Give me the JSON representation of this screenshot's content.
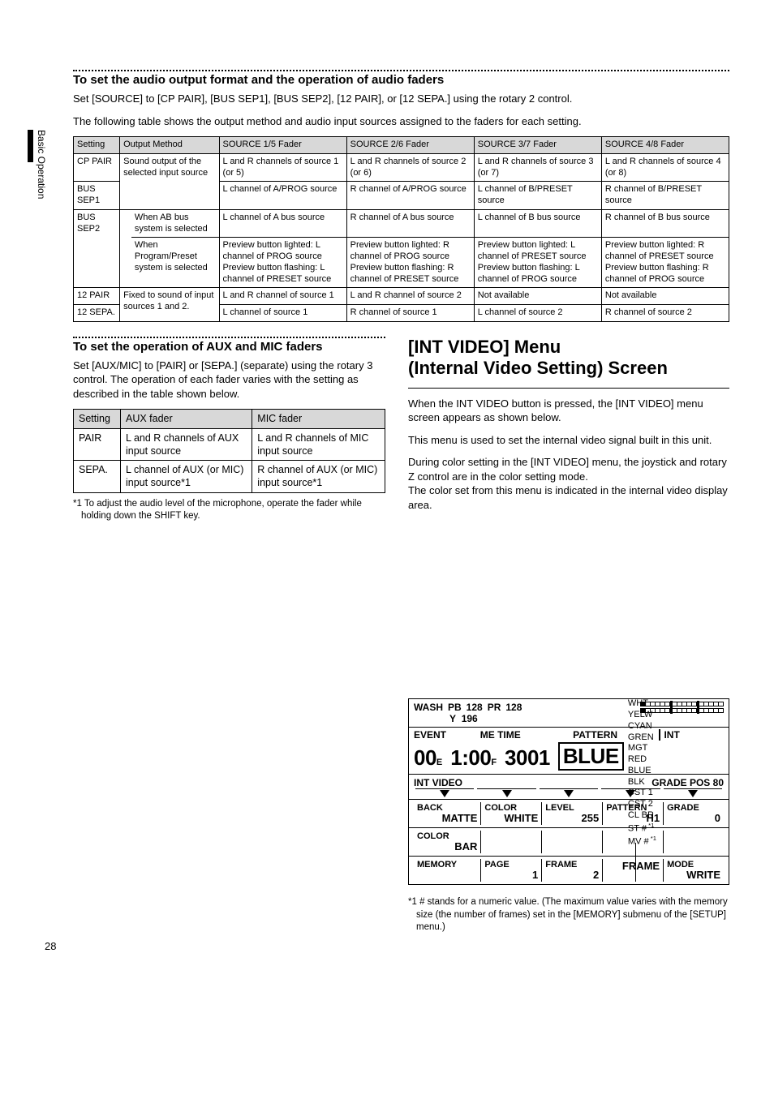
{
  "side_label": "Basic Operation",
  "page_number": "28",
  "sec1": {
    "heading": "To set the audio output format and the operation of audio faders",
    "p1": "Set [SOURCE] to [CP PAIR], [BUS SEP1], [BUS SEP2], [12 PAIR], or [12 SEPA.] using the rotary 2 control.",
    "p2": "The following table shows the output method and audio input sources assigned to the faders for each setting.",
    "headers": [
      "Setting",
      "Output Method",
      "SOURCE 1/5 Fader",
      "SOURCE 2/6 Fader",
      "SOURCE 3/7 Fader",
      "SOURCE 4/8 Fader"
    ],
    "r1": {
      "setting": "CP PAIR",
      "out": "Sound output of the selected input source",
      "c1": "L and R channels of source 1 (or 5)",
      "c2": "L and R channels of source 2 (or 6)",
      "c3": "L and R channels of source 3 (or 7)",
      "c4": "L and R channels of source 4 (or 8)"
    },
    "r2": {
      "setting": "BUS SEP1",
      "c1": "L channel of A/PROG source",
      "c2": "R channel of A/PROG source",
      "c3": "L channel of B/PRESET source",
      "c4": "R channel of B/PRESET source"
    },
    "r3": {
      "setting": "BUS SEP2",
      "cond1": "When AB bus system is selected",
      "c1": "L channel of A bus source",
      "c2": "R channel of A bus source",
      "c3": "L channel of B bus source",
      "c4": "R channel of B bus source"
    },
    "r3b": {
      "cond2": "When Program/Preset system is selected",
      "c1": "Preview button lighted: L channel of PROG source\nPreview button flashing: L channel of PRESET source",
      "c2": "Preview button lighted: R channel of PROG source\nPreview button flashing: R channel of PRESET source",
      "c3": "Preview button lighted: L channel of PRESET source\nPreview button flashing: L channel of PROG source",
      "c4": "Preview button lighted: R channel of PRESET source\nPreview button flashing: R channel of PROG source"
    },
    "r4": {
      "setting": "12 PAIR",
      "out": "Fixed to sound of input sources 1 and 2.",
      "c1": "L and R channel of source 1",
      "c2": "L and R channel of source 2",
      "c3": "Not available",
      "c4": "Not available"
    },
    "r5": {
      "setting": "12 SEPA.",
      "c1": "L channel of source 1",
      "c2": "R channel of source 1",
      "c3": "L channel of source 2",
      "c4": "R channel of source 2"
    }
  },
  "sec2": {
    "heading": "To set the operation of AUX and MIC faders",
    "p1": "Set [AUX/MIC] to [PAIR] or [SEPA.] (separate) using the rotary 3 control. The operation of each fader varies with the setting as described in the table shown below.",
    "headers": [
      "Setting",
      "AUX fader",
      "MIC fader"
    ],
    "r1": {
      "s": "PAIR",
      "a": "L and R channels of AUX input source",
      "m": "L and R channels of MIC input source"
    },
    "r2": {
      "s": "SEPA.",
      "a": "L channel of AUX (or MIC) input source*1",
      "m": "R channel of AUX (or MIC) input source*1"
    },
    "foot": "*1 To adjust the audio level of the microphone, operate the fader while holding down the SHIFT key."
  },
  "sec3": {
    "title1": "[INT VIDEO] Menu",
    "title2": "(Internal Video Setting) Screen",
    "p1": "When the INT VIDEO button is pressed, the [INT VIDEO] menu screen appears as shown below.",
    "p2": "This menu is used to set the internal video signal built in this unit.",
    "p3": "During color setting in the [INT VIDEO] menu, the joystick and rotary Z control are in the color setting mode.\nThe color set from this menu is indicated in the internal video display area.",
    "colors": [
      "WHT",
      "YELW",
      "CYAN",
      "GREN",
      "MGT",
      "RED",
      "BLUE",
      "BLK",
      "CST 1",
      "CST 2",
      "CL BR",
      "ST #",
      "MV #"
    ],
    "sup": "*1",
    "osd": {
      "wash_label": "WASH",
      "pb_l": "PB",
      "pb_v": "128",
      "pr_l": "PR",
      "pr_v": "128",
      "y_l": "Y",
      "y_v": "196",
      "event_l": "EVENT",
      "metime_l": "ME TIME",
      "pattern_l": "PATTERN",
      "int_l": "INT",
      "event_v": "00",
      "event_u": "E",
      "metime_v": "1:00",
      "metime_u": "F",
      "pattern_v": "3001",
      "int_v": "BLUE",
      "intvideo_l": "INT VIDEO",
      "grade_l": "GRADE POS 80",
      "row1": [
        {
          "t": "BACK",
          "b": "MATTE"
        },
        {
          "t": "COLOR",
          "b": "WHITE"
        },
        {
          "t": "LEVEL",
          "b": "255"
        },
        {
          "t": "PATTERN",
          "b": "H1"
        },
        {
          "t": "GRADE",
          "b": "0"
        }
      ],
      "row2": [
        {
          "t": "COLOR",
          "b": "BAR"
        },
        {
          "t": "",
          "b": ""
        },
        {
          "t": "",
          "b": ""
        },
        {
          "t": "",
          "b": ""
        },
        {
          "t": "",
          "b": ""
        }
      ],
      "row3": [
        {
          "t": "MEMORY",
          "b": ""
        },
        {
          "t": "PAGE",
          "b": "1"
        },
        {
          "t": "FRAME",
          "b": "2"
        },
        {
          "t": "",
          "b": "FRAME"
        },
        {
          "t": "MODE",
          "b": "WRITE"
        }
      ]
    },
    "foot": "*1 # stands for a numeric value. (The maximum value varies with the memory size (the number of frames) set in the [MEMORY] submenu of the [SETUP] menu.)"
  }
}
